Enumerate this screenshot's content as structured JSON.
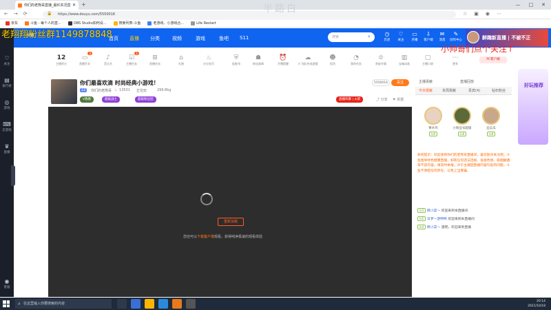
{
  "browser": {
    "tab_title": "你们的老熊哥直播_最红实况直播...",
    "url": "https://www.douyu.com/5550016",
    "window_controls": [
      "—",
      "□",
      "✕"
    ],
    "bookmarks": [
      "京东",
      "斗鱼 - 每个人的直...",
      "OBS Studio如何设...",
      "搜索列表-斗鱼",
      "老游戏、小游戏合...",
      "Life Restart"
    ]
  },
  "site": {
    "logo": "斗鱼",
    "nav": [
      "首页",
      "直播",
      "分类",
      "视频",
      "游戏",
      "鱼吧",
      "S11"
    ],
    "search_placeholder": "搜索",
    "header_icons": [
      "历史",
      "关注",
      "开播",
      "客户端",
      "消息",
      "创作中心"
    ],
    "promo": "鲜趣新直播 | 不被不正"
  },
  "sidebar": [
    {
      "label": "关注",
      "icon": "heart-icon"
    },
    {
      "label": "排行榜",
      "icon": "rank-icon"
    },
    {
      "label": "游戏",
      "icon": "gamepad-icon"
    },
    {
      "label": "云游戏",
      "icon": "cloud-game-icon"
    },
    {
      "label": "直播",
      "icon": "live-icon"
    },
    {
      "label": "客服",
      "icon": "service-icon"
    }
  ],
  "toolbar": [
    {
      "label": "主播积分",
      "value": "12"
    },
    {
      "label": "直播开关",
      "badge": "3"
    },
    {
      "label": "音乐台"
    },
    {
      "label": "主播任务",
      "badge": "1"
    },
    {
      "label": "直播任务"
    },
    {
      "label": "礼物"
    },
    {
      "label": "分分金币"
    },
    {
      "label": "金盾/车"
    },
    {
      "label": "粉丝勋章"
    },
    {
      "label": "开播提醒"
    },
    {
      "label": "小飞船/合成遊戲"
    },
    {
      "label": "投资"
    },
    {
      "label": "我的任务"
    },
    {
      "label": "贵族专属"
    },
    {
      "label": "宝箱动画"
    },
    {
      "label": "主播口袋"
    },
    {
      "label": "更多"
    }
  ],
  "stream": {
    "title": "你们最喜欢滴 时尚经典小游戏！",
    "streamer": "你们的老熊哥",
    "hot": "13531",
    "category": "正在玩",
    "subs": "299.8kg",
    "tags": [
      "V我看",
      "超级战士",
      "超级粉丝团"
    ],
    "room_id": "5550016",
    "follow": "关注",
    "right_badge": "直播风暴 | 火箭"
  },
  "player": {
    "reload_label": "重新加载",
    "hint_prefix": "您还可以",
    "hint_link": "下载客户端",
    "hint_suffix": "观看，获得纯净极速的观看体验"
  },
  "right_panel": {
    "top_links": [
      "主播贡献",
      "直播回放"
    ],
    "tabs": [
      "今日贡献",
      "本周贡献",
      "贵宾(4)",
      "钻石粉丝"
    ],
    "fans": [
      {
        "name": "胃水鸟",
        "level": "lv9"
      },
      {
        "name": "小粉丝号超级",
        "level": "lv8"
      },
      {
        "name": "丝瓜瓜",
        "level": "lv8"
      }
    ],
    "system_notice": "系统提示：欢迎来到你们的老熊哥直播间，喜欢就点关注吧。斗鱼倡导绿色健康直播，如有任何违法违规、低俗色情、吸烟酗酒等不良内容，请及时举报。对于主播因直播内容引起的问题，斗鱼不承担任何责任，以免上当受骗。",
    "chats": [
      {
        "tag": "lv3",
        "name": "韩小菜～",
        "msg": "欢迎来到本直播间"
      },
      {
        "tag": "lv5",
        "name": "日梦～游鸭鸭",
        "msg": "欢迎来到本直播间"
      },
      {
        "tag": "lv4",
        "name": "韩小菜～",
        "msg": "酒吧，欢迎来到直播"
      }
    ]
  },
  "overlays": {
    "top_left": "老翔翔粉丝群1149878848",
    "top_right": "小帅哥们点个关注↑",
    "top_center": "半路白",
    "promo": "好玩推荐"
  },
  "taskbar": {
    "search_placeholder": "在这里输入你要搜索的内容",
    "time": "20:14",
    "date": "2021/10/18"
  },
  "colors": {
    "brand": "#0f64f0",
    "accent": "#ff5d23",
    "player_bg": "#2d2d2d"
  }
}
